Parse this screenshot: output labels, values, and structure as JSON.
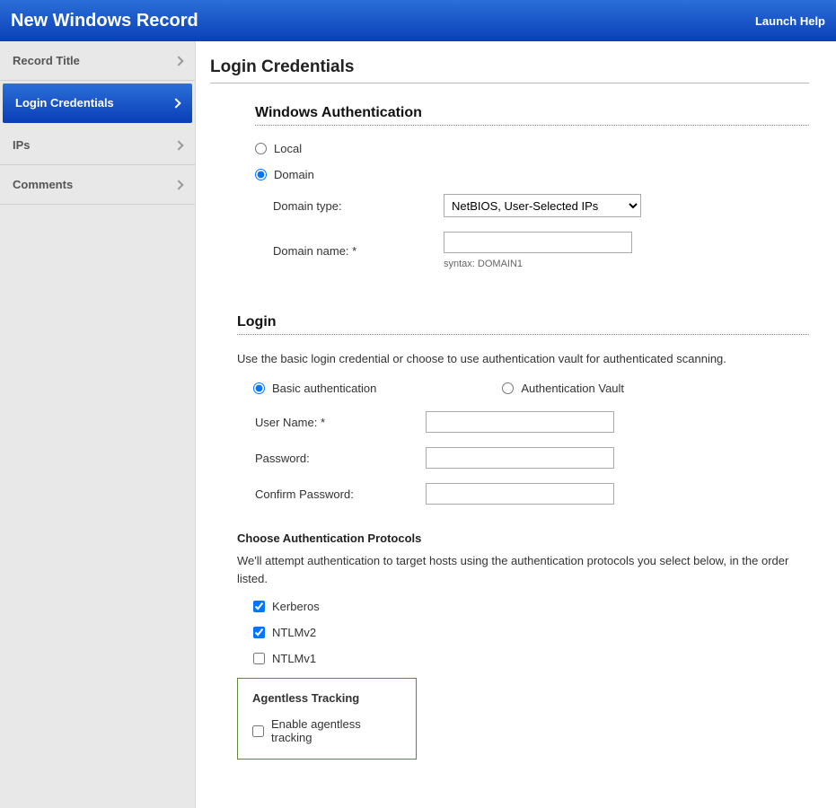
{
  "header": {
    "title": "New Windows Record",
    "help": "Launch Help"
  },
  "sidebar": {
    "items": [
      {
        "label": "Record Title",
        "active": false
      },
      {
        "label": "Login Credentials",
        "active": true
      },
      {
        "label": "IPs",
        "active": false
      },
      {
        "label": "Comments",
        "active": false
      }
    ]
  },
  "page": {
    "title": "Login Credentials"
  },
  "auth": {
    "title": "Windows Authentication",
    "local_label": "Local",
    "domain_label": "Domain",
    "selected": "domain",
    "domain_type_label": "Domain type:",
    "domain_type_value": "NetBIOS, User-Selected IPs",
    "domain_name_label": "Domain name: *",
    "domain_name_value": "",
    "domain_hint": "syntax: DOMAIN1"
  },
  "login": {
    "title": "Login",
    "desc": "Use the basic login credential or choose to use authentication vault for authenticated scanning.",
    "basic_label": "Basic authentication",
    "vault_label": "Authentication Vault",
    "selected": "basic",
    "username_label": "User Name: *",
    "username_value": "",
    "password_label": "Password:",
    "password_value": "",
    "confirm_label": "Confirm Password:",
    "confirm_value": ""
  },
  "protocols": {
    "title": "Choose Authentication Protocols",
    "desc": "We'll attempt authentication to target hosts using the authentication protocols you select below, in the order listed.",
    "items": [
      {
        "label": "Kerberos",
        "checked": true
      },
      {
        "label": "NTLMv2",
        "checked": true
      },
      {
        "label": "NTLMv1",
        "checked": false
      }
    ]
  },
  "agentless": {
    "title": "Agentless Tracking",
    "enable_label": "Enable agentless tracking",
    "checked": false
  }
}
